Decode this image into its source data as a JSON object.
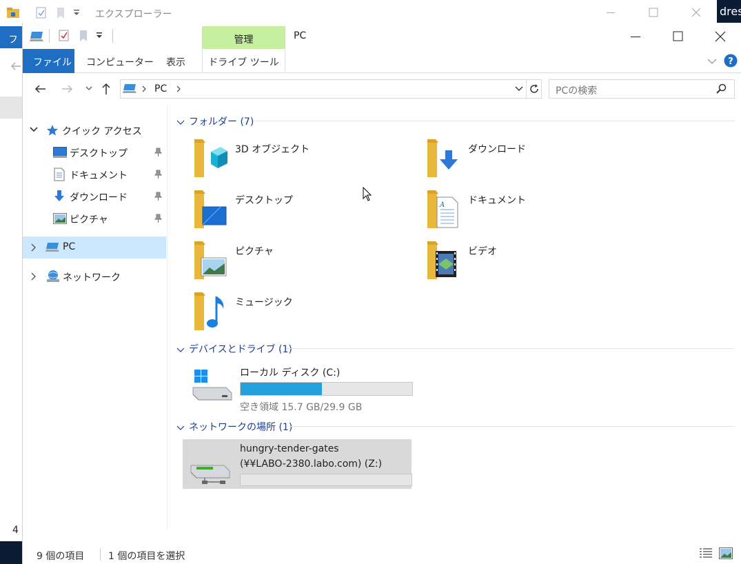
{
  "background_window": {
    "title": "エクスプローラー",
    "ribbon_file_partial": "ファ",
    "side_text_partial": "dres",
    "status_count_partial": "4"
  },
  "window": {
    "title": "PC",
    "ribbon_context_header": "管理",
    "tabs": {
      "file": "ファイル",
      "computer": "コンピューター",
      "view": "表示",
      "drive_tools": "ドライブ ツール"
    }
  },
  "address": {
    "location": "PC",
    "search_placeholder": "PCの検索"
  },
  "sidebar": {
    "quick_access": "クイック アクセス",
    "items": [
      {
        "label": "デスクトップ"
      },
      {
        "label": "ドキュメント"
      },
      {
        "label": "ダウンロード"
      },
      {
        "label": "ピクチャ"
      }
    ],
    "pc": "PC",
    "network": "ネットワーク"
  },
  "folders": {
    "header": "フォルダー (7)",
    "items": [
      {
        "label": "3D オブジェクト"
      },
      {
        "label": "ダウンロード"
      },
      {
        "label": "デスクトップ"
      },
      {
        "label": "ドキュメント"
      },
      {
        "label": "ピクチャ"
      },
      {
        "label": "ビデオ"
      },
      {
        "label": "ミュージック"
      }
    ]
  },
  "devices": {
    "header": "デバイスとドライブ (1)",
    "drive": {
      "name": "ローカル ディスク (C:)",
      "free_text": "空き領域 15.7 GB/29.9 GB",
      "used_fraction": 0.475
    }
  },
  "network_locations": {
    "header": "ネットワークの場所 (1)",
    "share_name": "hungry-tender-gates",
    "share_path": "(¥¥LABO-2380.labo.com) (Z:)"
  },
  "status": {
    "item_count": "9 個の項目",
    "selected": "1 個の項目を選択"
  },
  "colors": {
    "accent": "#1e6fc4",
    "context_tab": "#c6efa0",
    "selection": "#cce8ff",
    "group_header": "#1e3d8f",
    "progress": "#26a0da"
  }
}
